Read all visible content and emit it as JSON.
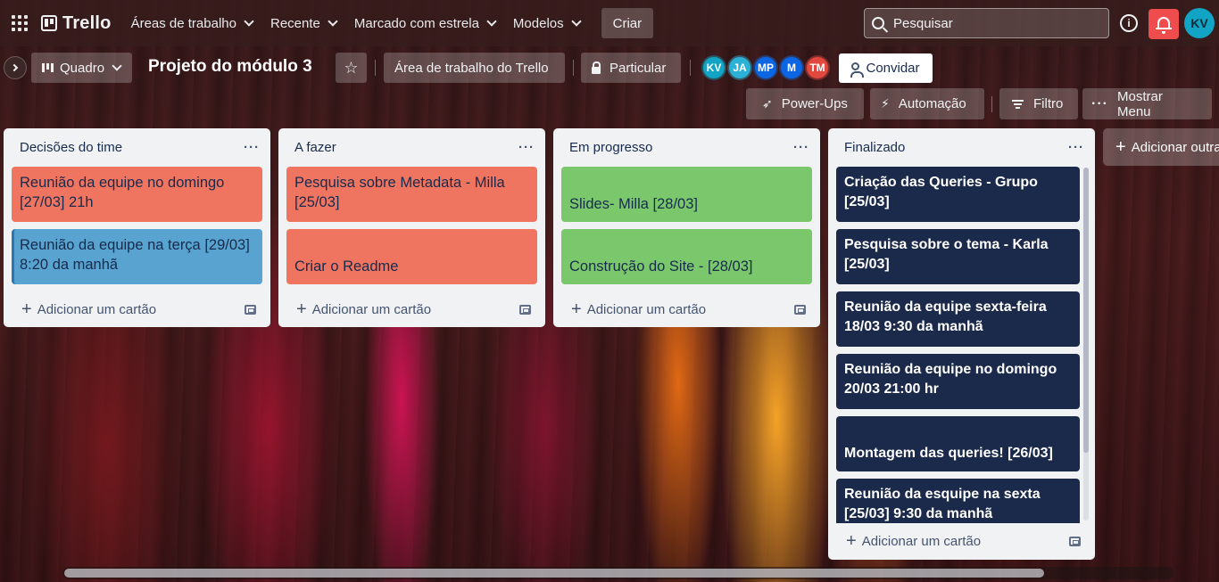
{
  "topbar": {
    "logo": "Trello",
    "nav": [
      {
        "label": "Áreas de trabalho"
      },
      {
        "label": "Recente"
      },
      {
        "label": "Marcado com estrela"
      },
      {
        "label": "Modelos"
      }
    ],
    "create_label": "Criar",
    "search_text": "Pesquisar",
    "info_icon": "i",
    "user_initials": "KV"
  },
  "board": {
    "view_label": "Quadro",
    "title": "Projeto do módulo 3",
    "star_icon": "☆",
    "workspace_label": "Área de trabalho do Trello",
    "visibility_label": "Particular",
    "members": [
      {
        "initials": "KV",
        "color": "#11a4c4"
      },
      {
        "initials": "JA",
        "color": "#2bb0d6"
      },
      {
        "initials": "MP",
        "color": "#0c66e4"
      },
      {
        "initials": "M",
        "color": "#0c66e4"
      },
      {
        "initials": "TM",
        "color": "#e2483d"
      }
    ],
    "invite_label": "Convidar",
    "powerups_label": "Power-Ups",
    "automation_label": "Automação",
    "filter_label": "Filtro",
    "menu_label": "Mostrar Menu"
  },
  "lists": [
    {
      "title": "Decisões do time",
      "menu": "···",
      "cards": [
        {
          "text": "Reunião da equipe no domingo [27/03] 21h",
          "color": "red"
        },
        {
          "text": "Reunião da equipe na terça [29/03] 8:20 da manhã",
          "color": "blue"
        }
      ],
      "add_label": "Adicionar um cartão"
    },
    {
      "title": "A fazer",
      "menu": "···",
      "cards": [
        {
          "text": "Pesquisa sobre Metadata - Milla [25/03]",
          "color": "red"
        },
        {
          "text": "Criar o Readme",
          "color": "red"
        }
      ],
      "add_label": "Adicionar um cartão"
    },
    {
      "title": "Em progresso",
      "menu": "···",
      "cards": [
        {
          "text": "Slides- Milla [28/03]",
          "color": "green"
        },
        {
          "text": "Construção do Site - [28/03]",
          "color": "green"
        }
      ],
      "add_label": "Adicionar um cartão"
    },
    {
      "title": "Finalizado",
      "menu": "···",
      "cards": [
        {
          "text": "Criação das Queries - Grupo [25/03]",
          "color": "navy"
        },
        {
          "text": "Pesquisa sobre o tema - Karla [25/03]",
          "color": "navy"
        },
        {
          "text": "Reunião da equipe sexta-feira 18/03 9:30 da manhã",
          "color": "navy"
        },
        {
          "text": "Reunião da equipe no domingo 20/03 21:00 hr",
          "color": "navy"
        },
        {
          "text": "Montagem das queries! [26/03]",
          "color": "navy"
        },
        {
          "text": "Reunião da esquipe na sexta [25/03] 9:30 da manhã",
          "color": "navy"
        }
      ],
      "add_label": "Adicionar um cartão"
    }
  ],
  "add_list_label": "Adicionar outra lista"
}
